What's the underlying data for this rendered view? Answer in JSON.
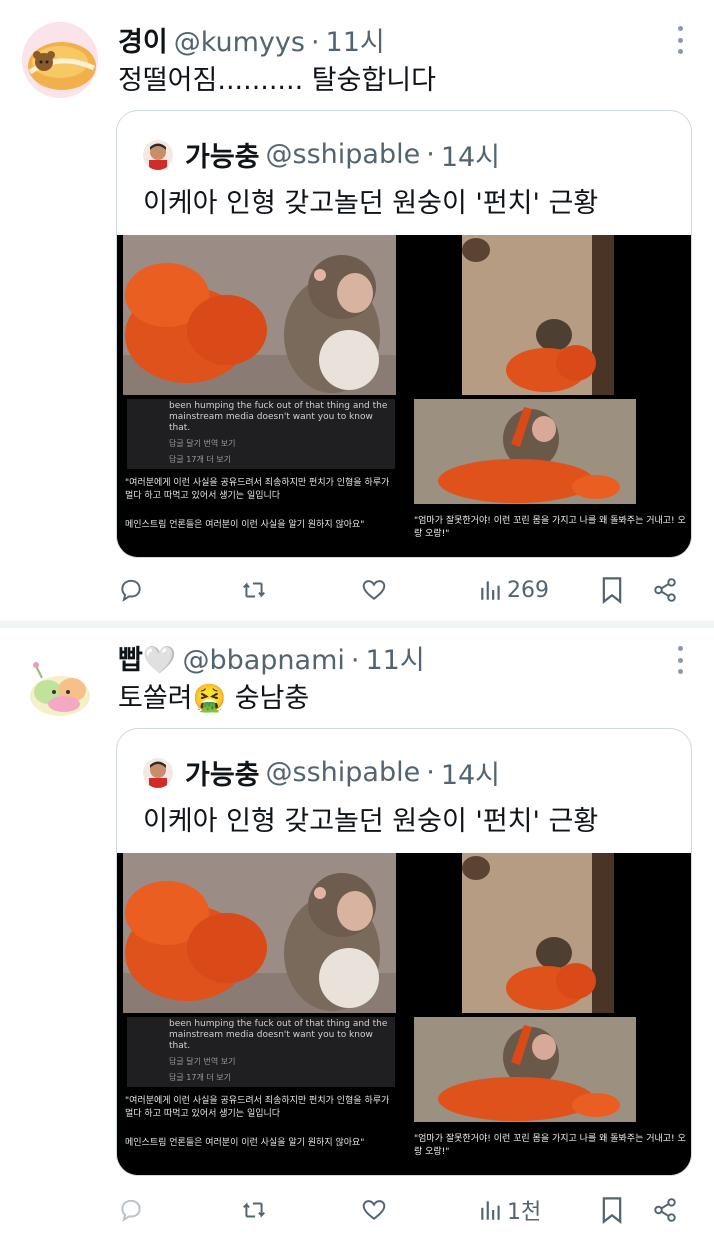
{
  "tweets": [
    {
      "display_name": "경이",
      "handle": "@kumyys",
      "dot": "·",
      "time": "11시",
      "text": "정떨어짐.......... 탈숭합니다",
      "quote": {
        "display_name": "가능충",
        "handle": "@sshipable",
        "dot": "·",
        "time": "14시",
        "text": "이케아 인형 갖고놀던 원숭이 '펀치' 근황",
        "caption_en": "been humping the fuck out of that thing and the mainstream media doesn't want you to know that.",
        "caption_btns": "답글 달기    번역 보기",
        "caption_more": "답글 17개 더 보기",
        "caption_ko1": "\"여러분에게 이런 사실을 공유드려서 죄송하지만 펀치가 인형을 하루가 멀다 하고 따먹고 있어서 생기는 일입니다",
        "caption_ko2": "메인스트림 언론들은 여러분이 이런 사실을 알기 원하지 않아요\"",
        "caption_right": "\"엄마가 잘못한거야! 이런 꼬린 몸을 가지고 나를 왜 돌봐주는 거내고! 오랑 오랑!\""
      },
      "actions": {
        "views": "269"
      }
    },
    {
      "display_name": "빱🤍",
      "handle": "@bbapnami",
      "dot": "·",
      "time": "11시",
      "text": "토쏠려🤮 숭남충",
      "quote": {
        "display_name": "가능충",
        "handle": "@sshipable",
        "dot": "·",
        "time": "14시",
        "text": "이케아 인형 갖고놀던 원숭이 '펀치' 근황",
        "caption_en": "been humping the fuck out of that thing and the mainstream media doesn't want you to know that.",
        "caption_btns": "답글 달기    번역 보기",
        "caption_more": "답글 17개 더 보기",
        "caption_ko1": "\"여러분에게 이런 사실을 공유드려서 죄송하지만 펀치가 인형을 하루가 멀다 하고 따먹고 있어서 생기는 일입니다",
        "caption_ko2": "메인스트림 언론들은 여러분이 이런 사실을 알기 원하지 않아요\"",
        "caption_right": "\"엄마가 잘못한거야! 이런 꼬린 몸을 가지고 나를 왜 돌봐주는 거내고! 오랑 오랑!\""
      },
      "actions": {
        "views": "1천"
      }
    }
  ],
  "icons": [
    "reply-icon",
    "retweet-icon",
    "like-icon",
    "views-icon",
    "bookmark-icon",
    "share-icon",
    "more-icon"
  ],
  "colors": {
    "text": "#0f1419",
    "secondary": "#536471",
    "border": "#cfd9de",
    "separator": "#eff3f4"
  }
}
